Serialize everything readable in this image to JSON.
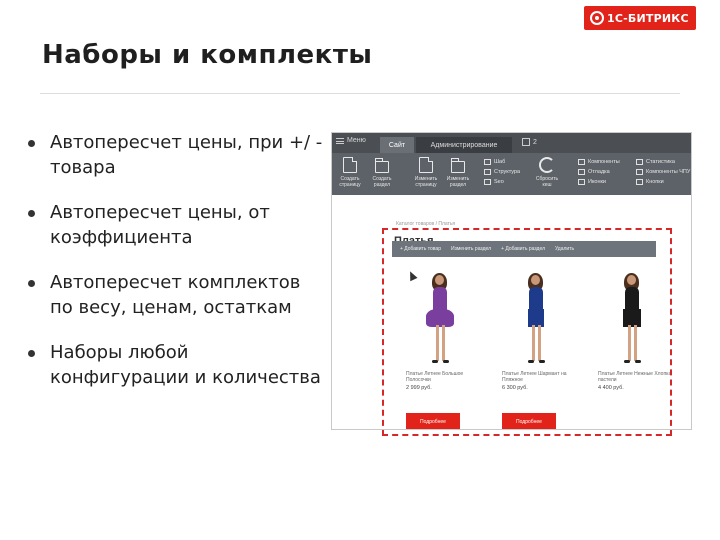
{
  "logo": {
    "text": "1С-БИТРИКС"
  },
  "title": "Наборы и комплекты",
  "bullets": [
    "Автопересчет цены, при +/ - товара",
    "Автопересчет цены, от коэффициента",
    "Автопересчет комплектов по весу, ценам, остаткам",
    "Наборы любой конфигурации и количества"
  ],
  "screenshot": {
    "menu_label": "Меню",
    "tabs": {
      "site": "Сайт",
      "admin": "Администрирование"
    },
    "counter": "2",
    "toolbar_buttons": [
      {
        "label": "Создать страницу",
        "icon": "new-page-icon"
      },
      {
        "label": "Создать раздел",
        "icon": "new-section-icon"
      },
      {
        "label": "Изменить страницу",
        "icon": "edit-page-icon"
      },
      {
        "label": "Изменить раздел",
        "icon": "edit-section-icon"
      }
    ],
    "toolbar_list_1": [
      "Шаб",
      "Структура",
      "Seo"
    ],
    "refresh_label": "Сбросить кеш",
    "toolbar_list_2": [
      "Компоненты",
      "Отладка",
      "Иконки"
    ],
    "toolbar_list_3": [
      "Статистика",
      "Компоненты ЧПУ",
      "Кнопки"
    ],
    "breadcrumb": "Каталог товаров / Платья",
    "page_heading": "Платья",
    "edit_bar": [
      "+ Добавить товар",
      "Изменить раздел",
      "+ Добавить раздел",
      "Удалить"
    ],
    "products": [
      {
        "name": "Платье Летнее Большое Полосочки",
        "price": "2 999 руб.",
        "dress": "#7a3f9e",
        "button": "Подробнее"
      },
      {
        "name": "Платье Летнее Шармант на Пляжное",
        "price": "6 300 руб.",
        "dress": "#1e3a8a",
        "button": "Подробнее"
      },
      {
        "name": "Платье Летнее Нежные Хлопка пастели",
        "price": "4 400 руб.",
        "dress": "#1a1a1a",
        "button": "Подробнее"
      }
    ]
  },
  "colors": {
    "accent": "#e2231a",
    "toolbar": "#5d6268",
    "dashed_frame": "#d62828"
  }
}
